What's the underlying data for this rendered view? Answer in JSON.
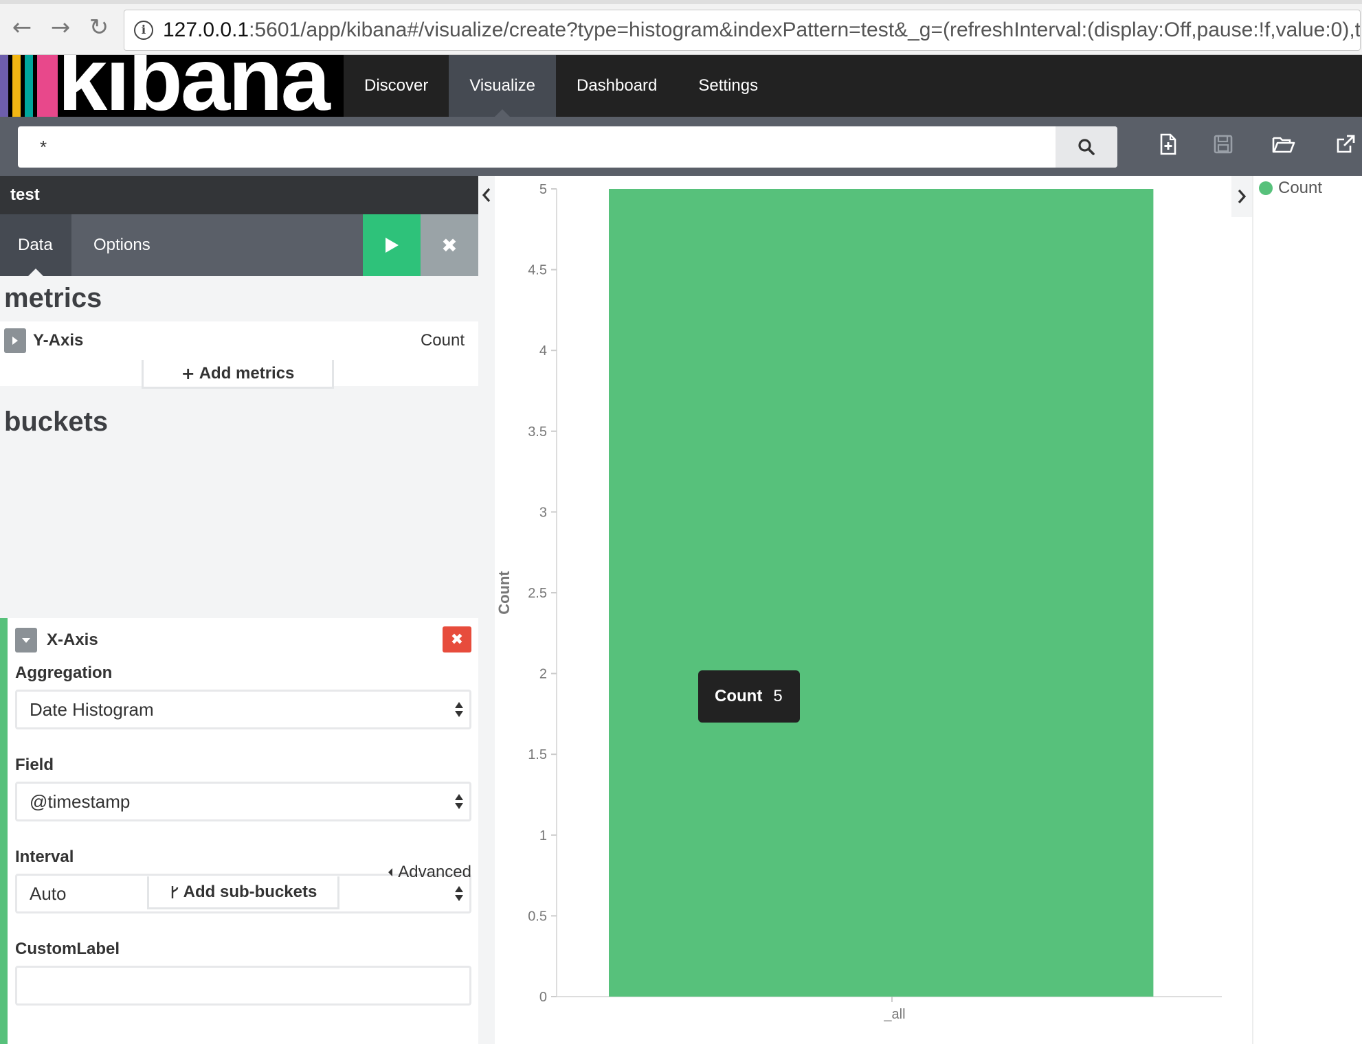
{
  "browser": {
    "url_host": "127.0.0.1",
    "url_rest": ":5601/app/kibana#/visualize/create?type=histogram&indexPattern=test&_g=(refreshInterval:(display:Off,pause:!f,value:0),ti…"
  },
  "header": {
    "logo_text": "kibana",
    "logo_stripes": [
      "#6d5eac",
      "#f2b613",
      "#00a79d",
      "#e8488b"
    ],
    "nav": [
      {
        "label": "Discover"
      },
      {
        "label": "Visualize"
      },
      {
        "label": "Dashboard"
      },
      {
        "label": "Settings"
      }
    ],
    "active_nav": "Visualize"
  },
  "query": {
    "value": "*"
  },
  "panel": {
    "title": "test",
    "tabs": {
      "data": "Data",
      "options": "Options"
    },
    "metrics_heading": "metrics",
    "y_axis": {
      "label": "Y-Axis",
      "value": "Count"
    },
    "add_metrics": "Add metrics",
    "buckets_heading": "buckets",
    "x_axis_label": "X-Axis",
    "aggregation": {
      "label": "Aggregation",
      "value": "Date Histogram"
    },
    "field": {
      "label": "Field",
      "value": "@timestamp"
    },
    "interval": {
      "label": "Interval",
      "value": "Auto"
    },
    "custom_label": {
      "label": "CustomLabel",
      "value": ""
    },
    "advanced": "Advanced",
    "add_sub_buckets": "Add sub-buckets"
  },
  "colors": {
    "accent": "#57c17b",
    "apply": "#2ec27a",
    "remove": "#e74c3c"
  },
  "legend": {
    "label": "Count"
  },
  "tooltip": {
    "label": "Count",
    "value": "5"
  },
  "chart_data": {
    "type": "bar",
    "categories": [
      "_all"
    ],
    "series": [
      {
        "name": "Count",
        "values": [
          5
        ]
      }
    ],
    "ylabel": "Count",
    "ylim": [
      0,
      5
    ],
    "yticks": [
      "0",
      "0.5",
      "1",
      "1.5",
      "2",
      "2.5",
      "3",
      "3.5",
      "4",
      "4.5",
      "5"
    ],
    "legend": "top-right",
    "color": "#57c17b"
  }
}
